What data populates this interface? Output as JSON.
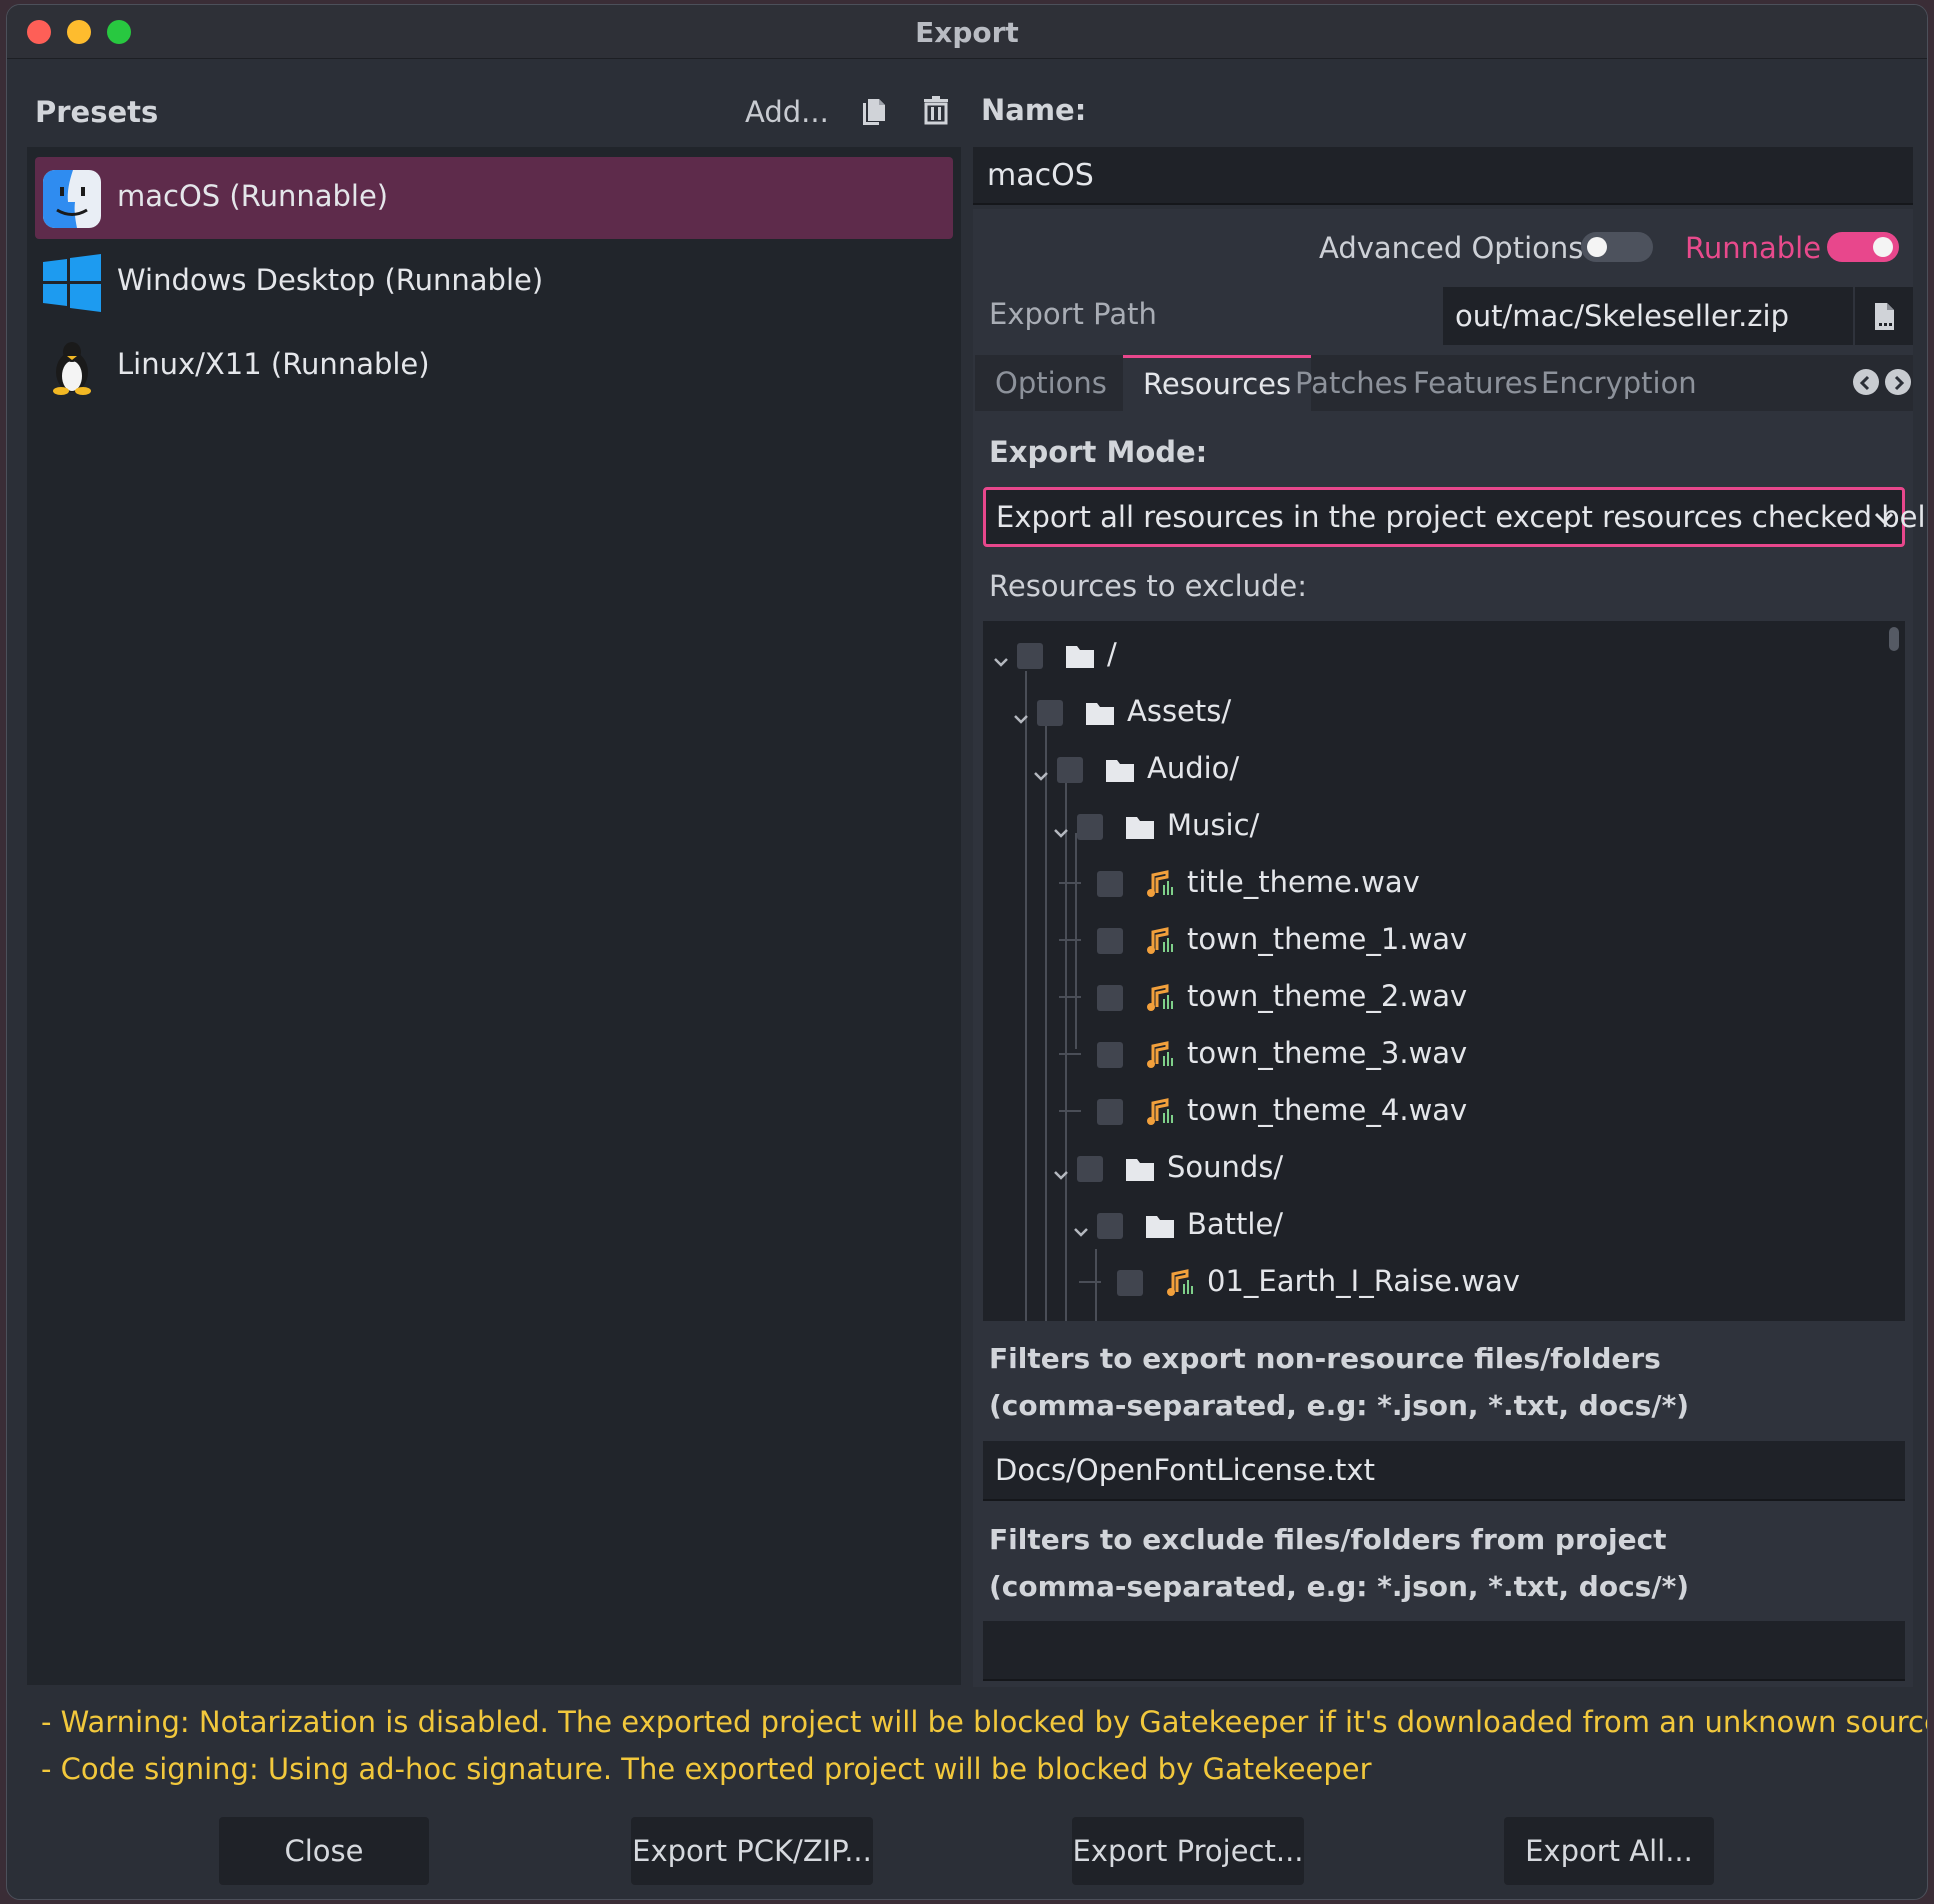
{
  "window": {
    "title": "Export"
  },
  "presets": {
    "header": "Presets",
    "add_label": "Add...",
    "items": [
      {
        "label": "macOS (Runnable)",
        "icon": "macos-finder-icon",
        "selected": true
      },
      {
        "label": "Windows Desktop (Runnable)",
        "icon": "windows-icon",
        "selected": false
      },
      {
        "label": "Linux/X11 (Runnable)",
        "icon": "linux-tux-icon",
        "selected": false
      }
    ]
  },
  "details": {
    "name_label": "Name:",
    "name_value": "macOS",
    "advanced_label": "Advanced Options",
    "advanced_on": false,
    "runnable_label": "Runnable",
    "runnable_on": true,
    "export_path_label": "Export Path",
    "export_path_value": "out/mac/Skeleseller.zip",
    "tabs": [
      {
        "label": "Options",
        "active": false
      },
      {
        "label": "Resources",
        "active": true
      },
      {
        "label": "Patches",
        "active": false
      },
      {
        "label": "Features",
        "active": false
      },
      {
        "label": "Encryption",
        "active": false
      }
    ],
    "export_mode_label": "Export Mode:",
    "export_mode_value": "Export all resources in the project except resources checked below",
    "resources_exclude_label": "Resources to exclude:",
    "tree": [
      {
        "label": "/",
        "type": "folder",
        "depth": 0
      },
      {
        "label": "Assets/",
        "type": "folder",
        "depth": 1
      },
      {
        "label": "Audio/",
        "type": "folder",
        "depth": 2
      },
      {
        "label": "Music/",
        "type": "folder",
        "depth": 3
      },
      {
        "label": "title_theme.wav",
        "type": "audio",
        "depth": 4
      },
      {
        "label": "town_theme_1.wav",
        "type": "audio",
        "depth": 4
      },
      {
        "label": "town_theme_2.wav",
        "type": "audio",
        "depth": 4
      },
      {
        "label": "town_theme_3.wav",
        "type": "audio",
        "depth": 4
      },
      {
        "label": "town_theme_4.wav",
        "type": "audio",
        "depth": 4
      },
      {
        "label": "Sounds/",
        "type": "folder",
        "depth": 3
      },
      {
        "label": "Battle/",
        "type": "folder",
        "depth": 4
      },
      {
        "label": "01_Earth_I_Raise.wav",
        "type": "audio",
        "depth": 5
      }
    ],
    "filters_include_label_1": "Filters to export non-resource files/folders",
    "filters_include_label_2": "(comma-separated, e.g: *.json, *.txt, docs/*)",
    "filters_include_value": "Docs/OpenFontLicense.txt",
    "filters_exclude_label_1": "Filters to exclude files/folders from project",
    "filters_exclude_label_2": "(comma-separated, e.g: *.json, *.txt, docs/*)",
    "filters_exclude_value": ""
  },
  "warnings": [
    "- Warning: Notarization is disabled. The exported project will be blocked by Gatekeeper if it's downloaded from an unknown source.",
    "- Code signing: Using ad-hoc signature. The exported project will be blocked by Gatekeeper"
  ],
  "buttons": {
    "close": "Close",
    "export_pck": "Export PCK/ZIP...",
    "export_project": "Export Project...",
    "export_all": "Export All..."
  },
  "colors": {
    "accent": "#e8478c",
    "selection": "#5e2b4b",
    "warning": "#f2c83c",
    "panel": "#21252b"
  }
}
